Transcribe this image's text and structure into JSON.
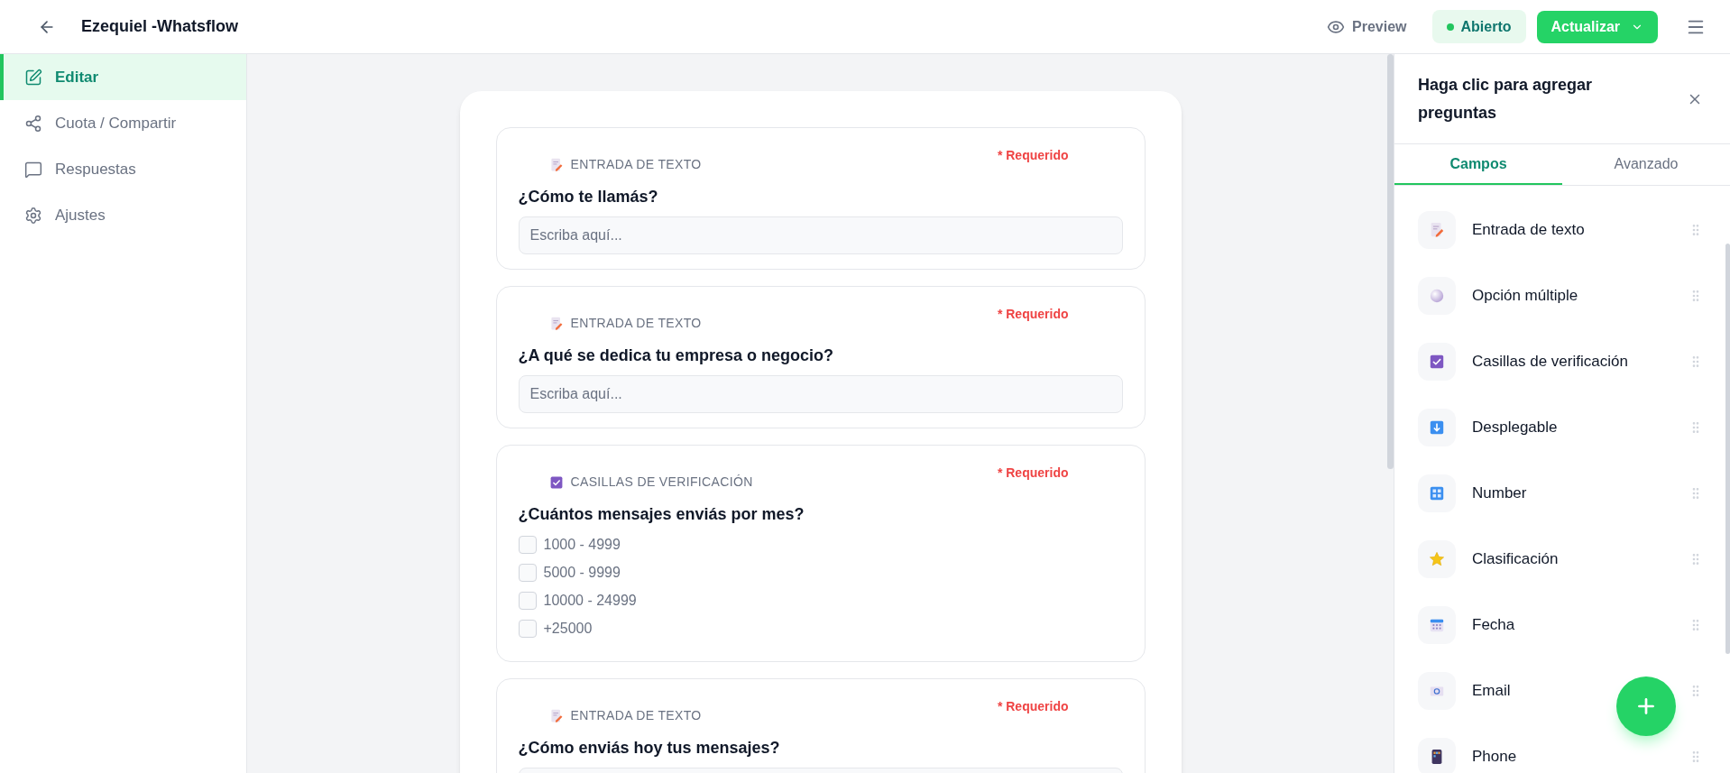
{
  "header": {
    "title": "Ezequiel -Whatsflow",
    "preview": "Preview",
    "status": "Abierto",
    "update": "Actualizar"
  },
  "sidebar": {
    "items": [
      {
        "label": "Editar",
        "kind": "edit",
        "selected": true
      },
      {
        "label": "Cuota / Compartir",
        "kind": "share",
        "selected": false
      },
      {
        "label": "Respuestas",
        "kind": "chat",
        "selected": false
      },
      {
        "label": "Ajustes",
        "kind": "settings",
        "selected": false
      }
    ]
  },
  "questions": [
    {
      "kind": "text",
      "type_label": "ENTRADA DE TEXTO",
      "required": "* Requerido",
      "title": "¿Cómo te llamás?",
      "placeholder": "Escriba aquí..."
    },
    {
      "kind": "text",
      "type_label": "ENTRADA DE TEXTO",
      "required": "* Requerido",
      "title": "¿A qué se dedica tu empresa o negocio?",
      "placeholder": "Escriba aquí..."
    },
    {
      "kind": "checkbox",
      "type_label": "CASILLAS DE VERIFICACIÓN",
      "required": "* Requerido",
      "title": "¿Cuántos mensajes enviás por mes?",
      "options": [
        {
          "label": "1000 - 4999",
          "checked": false
        },
        {
          "label": "5000 - 9999",
          "checked": false
        },
        {
          "label": "10000 - 24999",
          "checked": false
        },
        {
          "label": "+25000",
          "checked": false
        }
      ]
    },
    {
      "kind": "text",
      "type_label": "ENTRADA DE TEXTO",
      "required": "* Requerido",
      "title": "¿Cómo enviás hoy tus mensajes?"
    }
  ],
  "panel": {
    "title": "Haga clic para agregar preguntas",
    "tabs": [
      {
        "label": "Campos",
        "selected": true
      },
      {
        "label": "Avanzado",
        "selected": false
      }
    ],
    "fields": [
      {
        "label": "Entrada de texto",
        "kind": "text"
      },
      {
        "label": "Opción múltiple",
        "kind": "radio"
      },
      {
        "label": "Casillas de verificación",
        "kind": "checkbox"
      },
      {
        "label": "Desplegable",
        "kind": "dropdown"
      },
      {
        "label": "Number",
        "kind": "number"
      },
      {
        "label": "Clasificación",
        "kind": "rating"
      },
      {
        "label": "Fecha",
        "kind": "date"
      },
      {
        "label": "Email",
        "kind": "email"
      },
      {
        "label": "Phone",
        "kind": "phone"
      }
    ]
  }
}
